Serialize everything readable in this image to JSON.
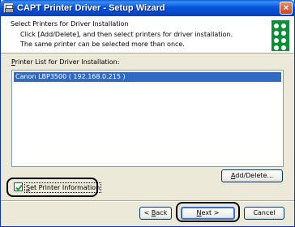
{
  "window": {
    "title": "CAPT Printer Driver - Setup Wizard",
    "close_symbol": "×"
  },
  "header": {
    "title": "Select Printers for Driver Installation",
    "line1": "Click [Add/Delete], and then select printers for driver installation.",
    "line2": "The same printer can be selected more than once."
  },
  "printer_list": {
    "label_mnemonic": "P",
    "label_rest": "rinter List for Driver Installation:",
    "items": [
      "Canon LBP3500 ( 192.168.0.215 )"
    ]
  },
  "buttons": {
    "add_delete_mnemonic": "A",
    "add_delete_rest": "dd/Delete...",
    "back_prefix": "< ",
    "back_mnemonic": "B",
    "back_rest": "ack",
    "next_mnemonic": "N",
    "next_rest": "ext >",
    "cancel": "Cancel"
  },
  "checkbox": {
    "label_mnemonic": "S",
    "label_rest": "et Printer Information",
    "checked": true
  },
  "colors": {
    "titlebar": "#0855dd",
    "selection": "#316ac5",
    "dialog_bg": "#ece9d8"
  }
}
